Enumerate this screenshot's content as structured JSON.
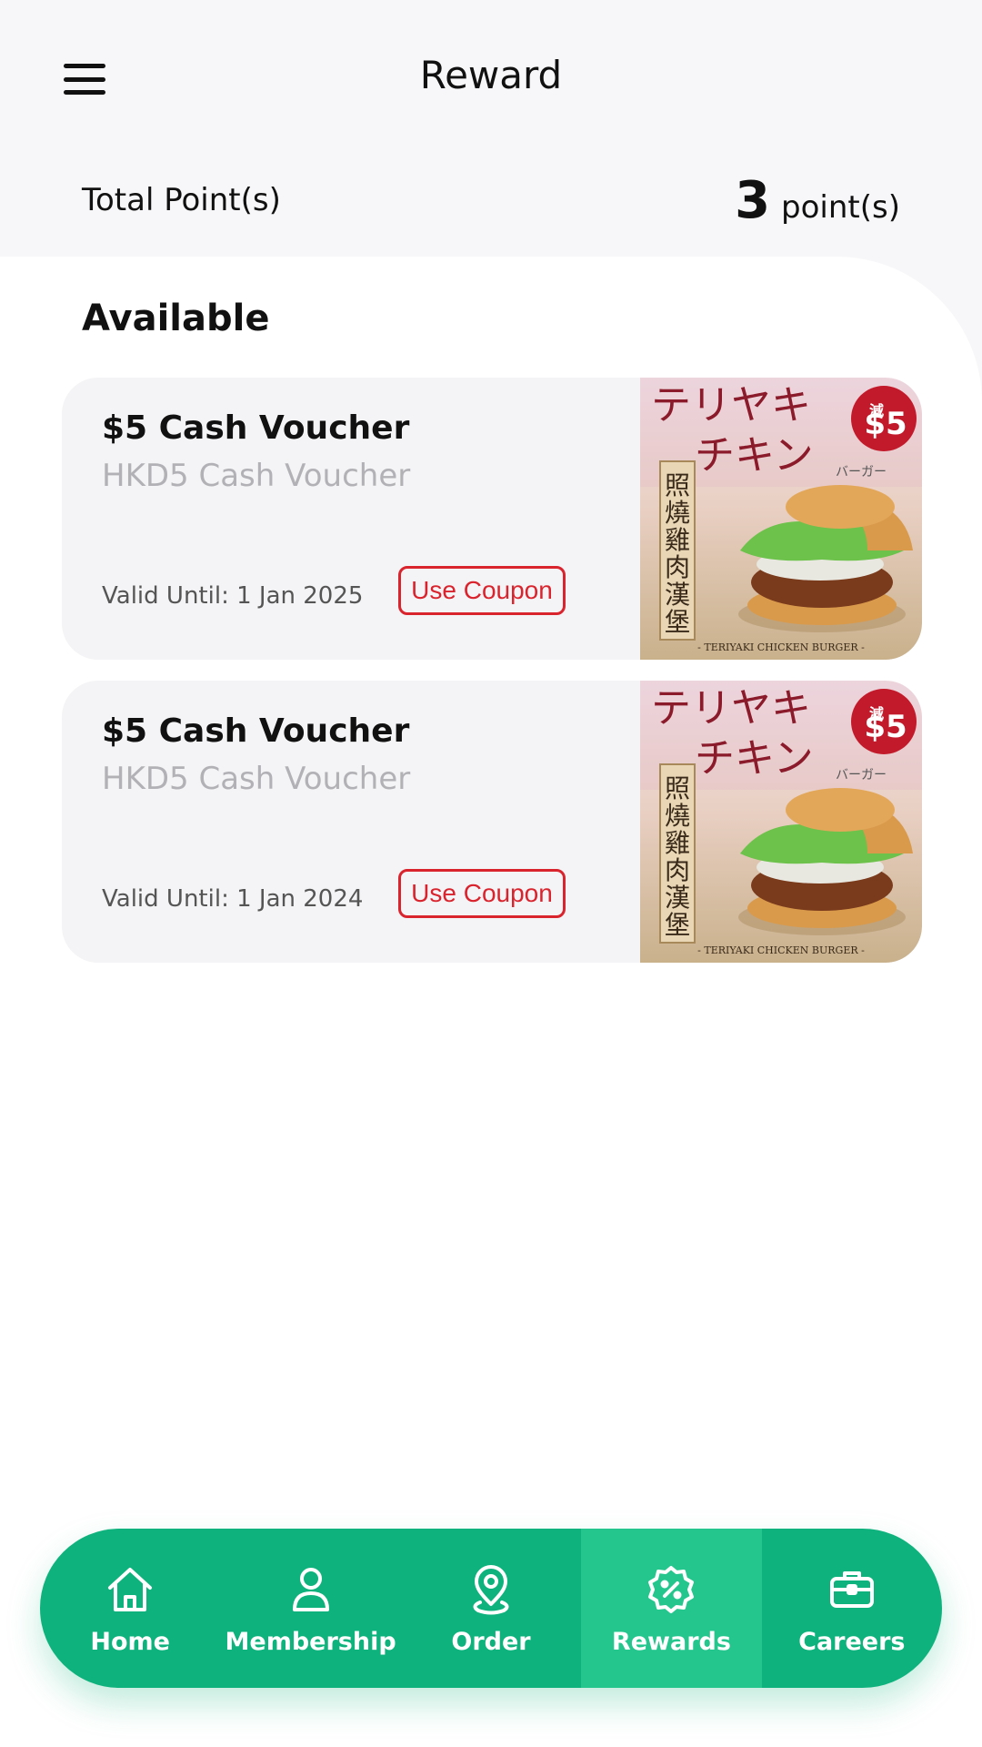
{
  "header": {
    "title": "Reward"
  },
  "points": {
    "label": "Total Point(s)",
    "value": "3",
    "unit": "point(s)"
  },
  "section": {
    "title": "Available"
  },
  "vouchers": [
    {
      "title": "$5 Cash Voucher",
      "subtitle": "HKD5 Cash Voucher",
      "valid": "Valid Until: 1 Jan 2025",
      "button": "Use Coupon",
      "image": {
        "headline": "テリヤキ",
        "headline2": "チキン",
        "small": "バーガー",
        "vertical": [
          "照",
          "燒",
          "雞",
          "肉",
          "漢",
          "堡"
        ],
        "badge_top": "減",
        "badge": "$5",
        "footer": "- TERIYAKI CHICKEN BURGER -"
      }
    },
    {
      "title": "$5 Cash Voucher",
      "subtitle": "HKD5 Cash Voucher",
      "valid": "Valid Until: 1 Jan 2024",
      "button": "Use Coupon",
      "image": {
        "headline": "テリヤキ",
        "headline2": "チキン",
        "small": "バーガー",
        "vertical": [
          "照",
          "燒",
          "雞",
          "肉",
          "漢",
          "堡"
        ],
        "badge_top": "減",
        "badge": "$5",
        "footer": "- TERIYAKI CHICKEN BURGER -"
      }
    }
  ],
  "nav": {
    "items": [
      {
        "label": "Home",
        "icon": "home-icon"
      },
      {
        "label": "Membership",
        "icon": "person-icon"
      },
      {
        "label": "Order",
        "icon": "location-pin-icon"
      },
      {
        "label": "Rewards",
        "icon": "discount-badge-icon"
      },
      {
        "label": "Careers",
        "icon": "briefcase-icon"
      }
    ],
    "active": "Rewards"
  },
  "colors": {
    "brand_green": "#0eb27c",
    "active_green": "#25c58e",
    "coupon_red": "#d9232d",
    "card_bg": "#f4f4f6"
  }
}
